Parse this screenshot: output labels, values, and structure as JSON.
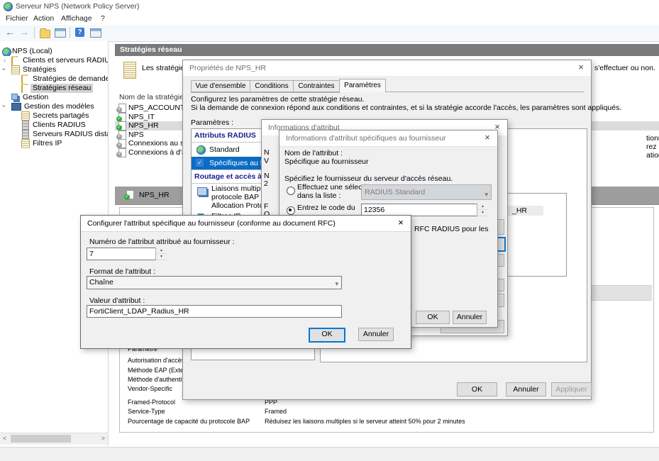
{
  "window": {
    "title": "Serveur NPS (Network Policy Server)"
  },
  "menubar": {
    "items": [
      "Fichier",
      "Action",
      "Affichage",
      "?"
    ]
  },
  "toolbar": {
    "back_glyph": "←",
    "forward_glyph": "→",
    "help_glyph": "?"
  },
  "tree": {
    "items": [
      {
        "label": "NPS (Local)",
        "icon": "globe",
        "expander": "none",
        "selected": false
      },
      {
        "label": "Clients et serveurs RADIUS",
        "icon": "folder",
        "expander": "collapsed",
        "selected": false
      },
      {
        "label": "Stratégies",
        "icon": "scroll",
        "expander": "expanded",
        "selected": false
      },
      {
        "label": "Stratégies de demande",
        "icon": "folder",
        "expander": "none",
        "selected": false
      },
      {
        "label": "Stratégies réseau",
        "icon": "folder-open",
        "expander": "none",
        "selected": true
      },
      {
        "label": "Gestion",
        "icon": "gestion",
        "expander": "none",
        "selected": false
      },
      {
        "label": "Gestion des modèles",
        "icon": "monitor",
        "expander": "expanded",
        "selected": false
      },
      {
        "label": "Secrets partagés",
        "icon": "scroll",
        "expander": "none",
        "selected": false
      },
      {
        "label": "Clients RADIUS",
        "icon": "server",
        "expander": "none",
        "selected": false
      },
      {
        "label": "Serveurs RADIUS distan",
        "icon": "server",
        "expander": "none",
        "selected": false
      },
      {
        "label": "Filtres IP",
        "icon": "scroll",
        "expander": "none",
        "selected": false
      }
    ],
    "hscroll_left_glyph": "<",
    "hscroll_right_glyph": ">"
  },
  "content": {
    "header": "Stratégies réseau",
    "description_left": "Les stratégies ré",
    "description_right": "s'effectuer ou non.",
    "list": {
      "column_header": "Nom de la stratégie",
      "rows": [
        {
          "name": "NPS_ACCOUNTING",
          "status": "disabled"
        },
        {
          "name": "NPS_IT",
          "status": "enabled"
        },
        {
          "name": "NPS_HR",
          "status": "enabled"
        },
        {
          "name": "NPS",
          "status": "disabled"
        },
        {
          "name": "Connexions au serveu",
          "status": "disabled"
        },
        {
          "name": "Connexions à d'autres",
          "status": "disabled"
        }
      ]
    },
    "selected_bar": {
      "label": "NPS_HR"
    },
    "details": {
      "rows": [
        {
          "label": "Paramètre",
          "value": ""
        },
        {
          "label": "Autorisation d'accès",
          "value": ""
        },
        {
          "label": "Méthode EAP (Extens",
          "value": ""
        },
        {
          "label": "Méthode d'authentific",
          "value": ""
        },
        {
          "label": "Vendor-Specific",
          "value": ""
        },
        {
          "label": "Framed-Protocol",
          "value": "PPP"
        },
        {
          "label": "Service-Type",
          "value": "Framed"
        },
        {
          "label": "Pourcentage de capacité du protocole BAP",
          "value": "Réduisez les liaisons multiples si le serveur atteint 50% pour 2 minutes"
        }
      ]
    }
  },
  "dialog_properties": {
    "title": "Propriétés de NPS_HR",
    "close_glyph": "×",
    "tabs": [
      "Vue d'ensemble",
      "Conditions",
      "Contraintes",
      "Paramètres"
    ],
    "intro_line1": "Configurez les paramètres de cette stratégie réseau.",
    "intro_line2": "Si la demande de connexion répond aux conditions et contraintes, et si la stratégie accorde l'accès, les paramètres sont appliqués.",
    "settings_label": "Paramètres :",
    "settings_list": {
      "group1": "Attributs RADIUS",
      "item_standard": "Standard",
      "item_vendor": "Spécifiques au fourni",
      "group2": "Routage et accès à dis",
      "item_bap_line1": "Liaisons multiples et",
      "item_bap_line2": "protocole BAP (Band",
      "item_bap_line3": "Allocation Protocol)",
      "item_filters": "Filtres IP"
    },
    "right_fragment1": "tionnez un attribut",
    "right_fragment2": "rez pas d'attribut.",
    "right_fragment3": "ation de votre client",
    "attr_list_fragment": "_HR",
    "buttons": {
      "ok": "OK",
      "cancel": "Annuler",
      "apply": "Appliquer"
    }
  },
  "dialog_attr_info": {
    "title": "Informations d'attribut",
    "close_glyph": "×",
    "fragments": [
      "N",
      "V",
      "N",
      "2",
      "F",
      "O",
      "V"
    ]
  },
  "dialog_vendor": {
    "title": "Informations d'attribut spécifiques au fournisseur",
    "close_glyph": "×",
    "attr_name_label": "Nom de l'attribut :",
    "attr_name_value": "Spécifique au fournisseur",
    "vendor_label": "Spécifiez le fournisseur du serveur d'accès réseau.",
    "radio_select_line1": "Effectuez une sélection",
    "radio_select_line2": "dans la liste :",
    "vendor_dropdown_value": "RADIUS Standard",
    "radio_code_label": "Entrez le code du",
    "vendor_code_value": "12356",
    "rfc_fragment": "RFC RADIUS pour les",
    "buttons": {
      "ok": "OK",
      "cancel": "Annuler"
    }
  },
  "dialog_configure": {
    "title": "Configurer l'attribut spécifique au fournisseur (conforme au document RFC)",
    "close_glyph": "×",
    "number_label": "Numéro de l'attribut attribué au fournisseur :",
    "number_value": "7",
    "format_label": "Format de l'attribut :",
    "format_value": "Chaîne",
    "value_label": "Valeur d'attribut :",
    "value_value": "FortiClient_LDAP_Radius_HR",
    "buttons": {
      "ok": "OK",
      "cancel": "Annuler"
    }
  },
  "colors": {
    "selection_blue": "#0a6cc4",
    "section_navy": "#1b1b8f",
    "header_gray": "#7a7a7a",
    "bar_gray": "#9d9d9d",
    "enabled_green": "#2fae3c"
  }
}
